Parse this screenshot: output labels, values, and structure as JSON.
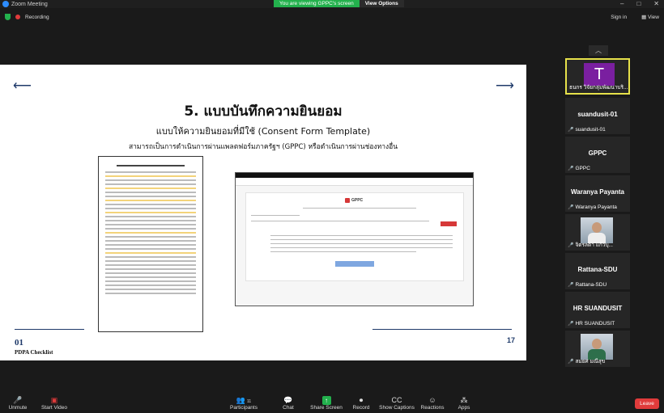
{
  "window": {
    "title": "Zoom Meeting",
    "controls": [
      "–",
      "□",
      "✕"
    ]
  },
  "banner": {
    "viewing": "You are viewing GPPC's screen",
    "view_options": "View Options"
  },
  "topbar": {
    "recording": "Recording",
    "sign_in": "Sign in",
    "view": "View"
  },
  "slide": {
    "title": "5. แบบบันทึกความยินยอม",
    "subtitle": "แบบให้ความยินยอมที่มีใช้ (Consent Form Template)",
    "subtitle2": "สามารถเป็นการดำเนินการผ่านแพลตฟอร์มภาครัฐฯ (GPPC) หรือดำเนินการผ่านช่องทางอื่น",
    "web_logo": "GPPC",
    "footer_num": "01",
    "footer_text": "PDPA Checklist",
    "page_number": "17",
    "arrow_left": "⟵",
    "arrow_right": "⟶"
  },
  "gallery": {
    "scroll_up": "︿",
    "tiles": [
      {
        "type": "avatar",
        "initial": "T",
        "label": "ธนกร วิจัยกลุ่มพัฒนาบริ...",
        "active": true
      },
      {
        "type": "name",
        "center": "suandusit-01",
        "label": "suandusit-01"
      },
      {
        "type": "name",
        "center": "GPPC",
        "label": "GPPC"
      },
      {
        "type": "name",
        "center": "Waranya Payanta",
        "label": "Waranya Payanta"
      },
      {
        "type": "video",
        "label": "จิตรลดา แก้วบุ..."
      },
      {
        "type": "name",
        "center": "Rattana-SDU",
        "label": "Rattana-SDU"
      },
      {
        "type": "name",
        "center": "HR SUANDUSIT",
        "label": "HR SUANDUSIT"
      },
      {
        "type": "video",
        "label": "สมยศ มณีสุข"
      }
    ]
  },
  "toolbar": {
    "unmute": "Unmute",
    "start_video": "Start Video",
    "participants": "Participants",
    "participants_count": "11",
    "chat": "Chat",
    "share_screen": "Share Screen",
    "record": "Record",
    "show_captions": "Show Captions",
    "reactions": "Reactions",
    "apps": "Apps",
    "leave": "Leave"
  }
}
